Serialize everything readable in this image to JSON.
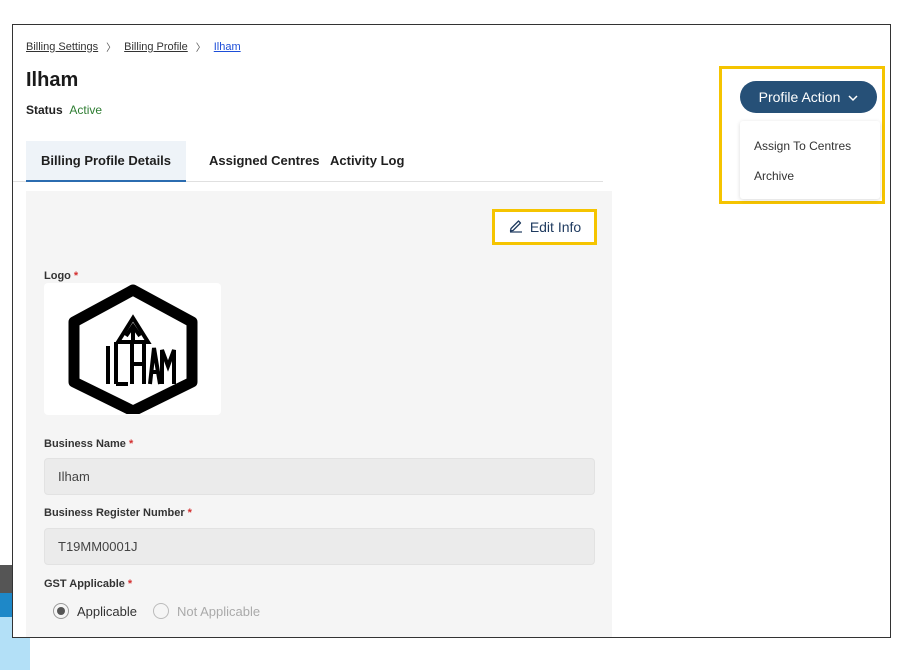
{
  "breadcrumb": {
    "items": [
      "Billing Settings",
      "Billing Profile",
      "Ilham"
    ],
    "separator": "〉"
  },
  "page": {
    "title": "Ilham",
    "status_label": "Status",
    "status_value": "Active"
  },
  "tabs": [
    {
      "label": "Billing Profile Details",
      "active": true
    },
    {
      "label": "Assigned Centres",
      "active": false
    },
    {
      "label": "Activity Log",
      "active": false
    }
  ],
  "actions": {
    "edit_label": "Edit Info",
    "edit_icon": "pencil-icon",
    "profile_action_label": "Profile Action",
    "profile_action_icon": "chevron-down-icon",
    "menu": [
      "Assign To Centres",
      "Archive"
    ]
  },
  "form": {
    "logo_label": "Logo",
    "required_mark": "*",
    "logo_alt": "ILHAM",
    "business_name_label": "Business Name",
    "business_name_value": "Ilham",
    "register_number_label": "Business Register Number",
    "register_number_value": "T19MM0001J",
    "gst_label": "GST Applicable",
    "gst_options": [
      "Applicable",
      "Not Applicable"
    ],
    "gst_selected": "Applicable"
  },
  "colors": {
    "brand": "#265077",
    "highlight": "#f5c400",
    "status_active": "#2e7d32",
    "required": "#d32f2f"
  }
}
